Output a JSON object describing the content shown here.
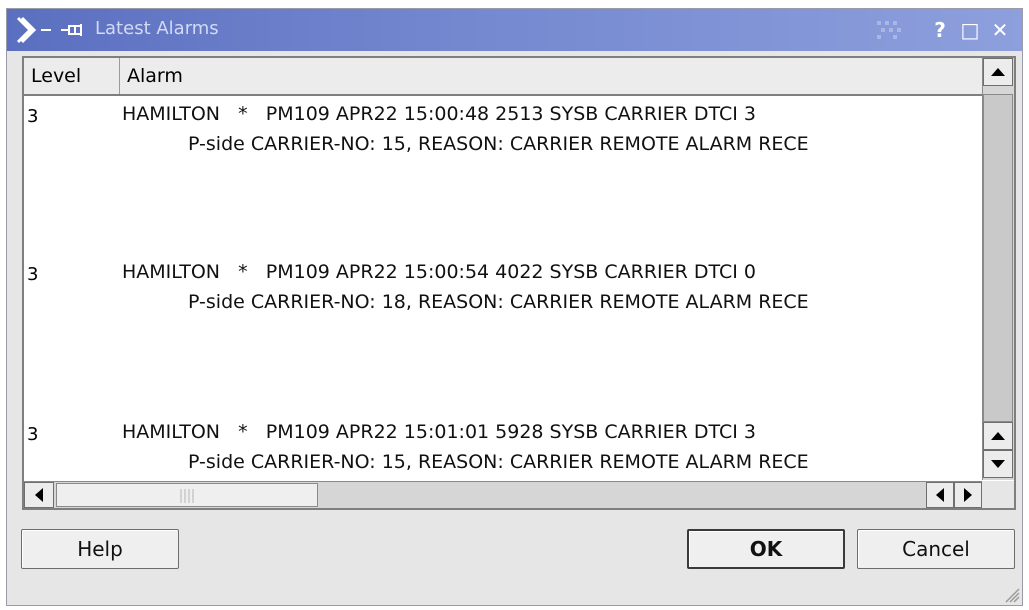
{
  "window": {
    "title": "Latest Alarms",
    "titlebar_buttons": {
      "help": "?",
      "maximize": "□",
      "close": "✕"
    }
  },
  "columns": [
    "Level",
    "Alarm"
  ],
  "alarms": [
    {
      "level": "3",
      "line1": "HAMILTON   *   PM109 APR22 15:00:48 2513 SYSB CARRIER DTCI 3",
      "line2": "P-side CARRIER-NO: 15, REASON: CARRIER REMOTE ALARM RECE"
    },
    {
      "level": "3",
      "line1": "HAMILTON   *   PM109 APR22 15:00:54 4022 SYSB CARRIER DTCI 0",
      "line2": "P-side CARRIER-NO: 18, REASON: CARRIER REMOTE ALARM RECE"
    },
    {
      "level": "3",
      "line1": "HAMILTON   *   PM109 APR22 15:01:01 5928 SYSB CARRIER DTCI 3",
      "line2": "P-side CARRIER-NO: 15, REASON: CARRIER REMOTE ALARM RECE"
    }
  ],
  "buttons": {
    "help": "Help",
    "ok": "OK",
    "cancel": "Cancel"
  },
  "icons": {
    "app": "x-logo-icon",
    "pin": "pin-icon",
    "scroll_up": "arrow-up-icon",
    "scroll_down": "arrow-down-icon",
    "scroll_left": "arrow-left-icon",
    "scroll_right": "arrow-right-icon",
    "resize": "resize-grip-icon"
  },
  "colors": {
    "titlebar_start": "#5b6fc0",
    "titlebar_end": "#8d9fdc",
    "window_bg": "#e6e6e6",
    "list_bg": "#ffffff"
  }
}
